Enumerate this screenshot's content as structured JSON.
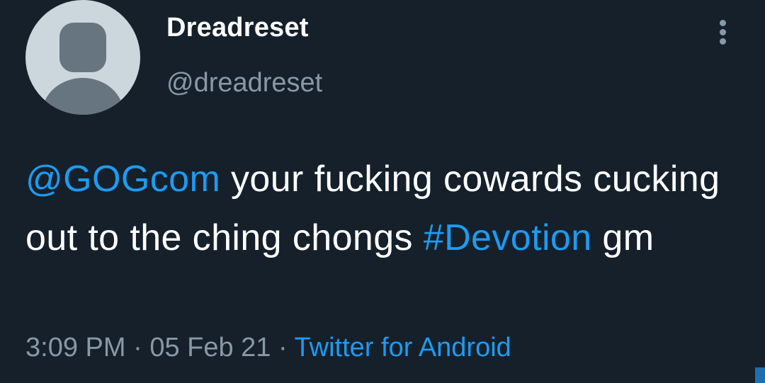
{
  "author": {
    "display_name": "Dreadreset",
    "handle": "@dreadreset",
    "avatar_icon": "default-avatar-icon"
  },
  "menu": {
    "icon": "more-vertical-icon"
  },
  "tweet": {
    "mention": "@GOGcom",
    "text_1": " your fucking cowards cucking out to the ching chongs ",
    "hashtag": "#Devotion",
    "text_2": " gm"
  },
  "meta": {
    "time": "3:09 PM",
    "sep1": " · ",
    "date": "05 Feb 21",
    "sep2": " · ",
    "source": "Twitter for Android"
  },
  "colors": {
    "background": "#15202b",
    "link": "#1d9bf0",
    "secondary_text": "#8899a6",
    "primary_text": "#ffffff",
    "avatar_bg": "#ccd6dd",
    "avatar_fg": "#66757f"
  }
}
